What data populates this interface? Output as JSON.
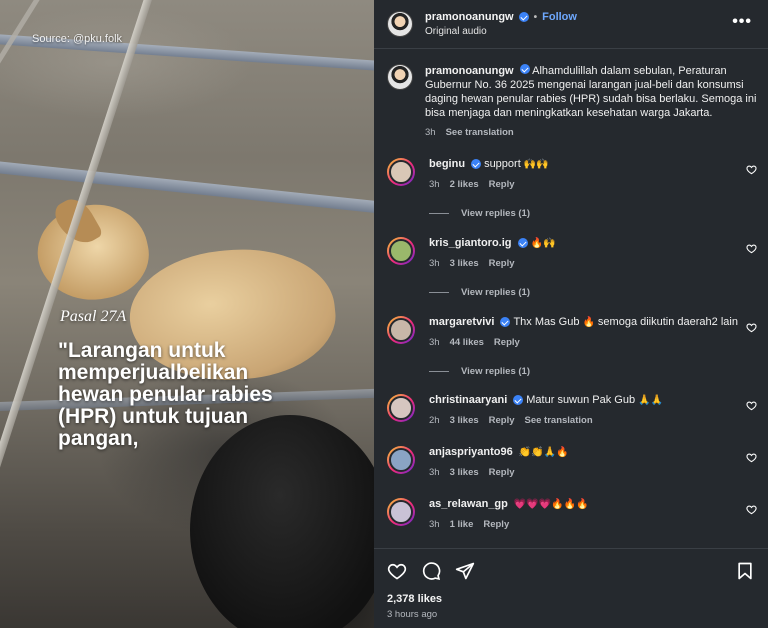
{
  "media": {
    "source": "Source: @pku.folk",
    "pasal": "Pasal 27A",
    "quote": "\"Larangan untuk\nmemperjualbelikan\nhewan penular rabies\n(HPR) untuk tujuan\npangan,"
  },
  "header": {
    "username": "pramonoanungw",
    "separator": "•",
    "follow": "Follow",
    "audio": "Original audio",
    "more": "•••"
  },
  "caption": {
    "username": "pramonoanungw",
    "text": "Alhamdulillah dalam sebulan, Peraturan Gubernur No. 36 2025 mengenai larangan jual-beli dan konsumsi daging hewan penular rabies (HPR) sudah bisa berlaku. Semoga ini bisa menjaga dan meningkatkan kesehatan warga Jakarta.",
    "time": "3h",
    "see_translation": "See translation"
  },
  "comments": [
    {
      "username": "beginu",
      "verified": true,
      "text": "support",
      "emoji": "🙌🙌",
      "time": "3h",
      "likes": "2 likes",
      "reply": "Reply",
      "view_replies": "View replies (1)",
      "avatar_color": "#d9c7b6"
    },
    {
      "username": "kris_giantoro.ig",
      "verified": true,
      "text": "",
      "emoji": "🔥🙌",
      "time": "3h",
      "likes": "3 likes",
      "reply": "Reply",
      "view_replies": "View replies (1)",
      "avatar_color": "#9ab86b"
    },
    {
      "username": "margaretvivi",
      "verified": true,
      "text": "Thx Mas Gub",
      "emoji": "🔥",
      "text2": "semoga diikutin daerah2 lain",
      "time": "3h",
      "likes": "44 likes",
      "reply": "Reply",
      "view_replies": "View replies (1)",
      "avatar_color": "#c8b7a8"
    },
    {
      "username": "christinaaryani",
      "verified": true,
      "text": "Matur suwun Pak Gub",
      "emoji": "🙏🙏",
      "time": "2h",
      "likes": "3 likes",
      "reply": "Reply",
      "see_translation": "See translation",
      "avatar_color": "#d6c6c0"
    },
    {
      "username": "anjaspriyanto96",
      "verified": false,
      "text": "",
      "emoji": "👏👏🙏🔥",
      "time": "3h",
      "likes": "3 likes",
      "reply": "Reply",
      "avatar_color": "#8aa4c4"
    },
    {
      "username": "as_relawan_gp",
      "verified": false,
      "text": "",
      "emoji": "💗💗💗🔥🔥🔥",
      "time": "3h",
      "likes": "1 like",
      "reply": "Reply",
      "avatar_color": "#c9c2d6"
    }
  ],
  "footer": {
    "likes": "2,378 likes",
    "time": "3 hours ago"
  }
}
